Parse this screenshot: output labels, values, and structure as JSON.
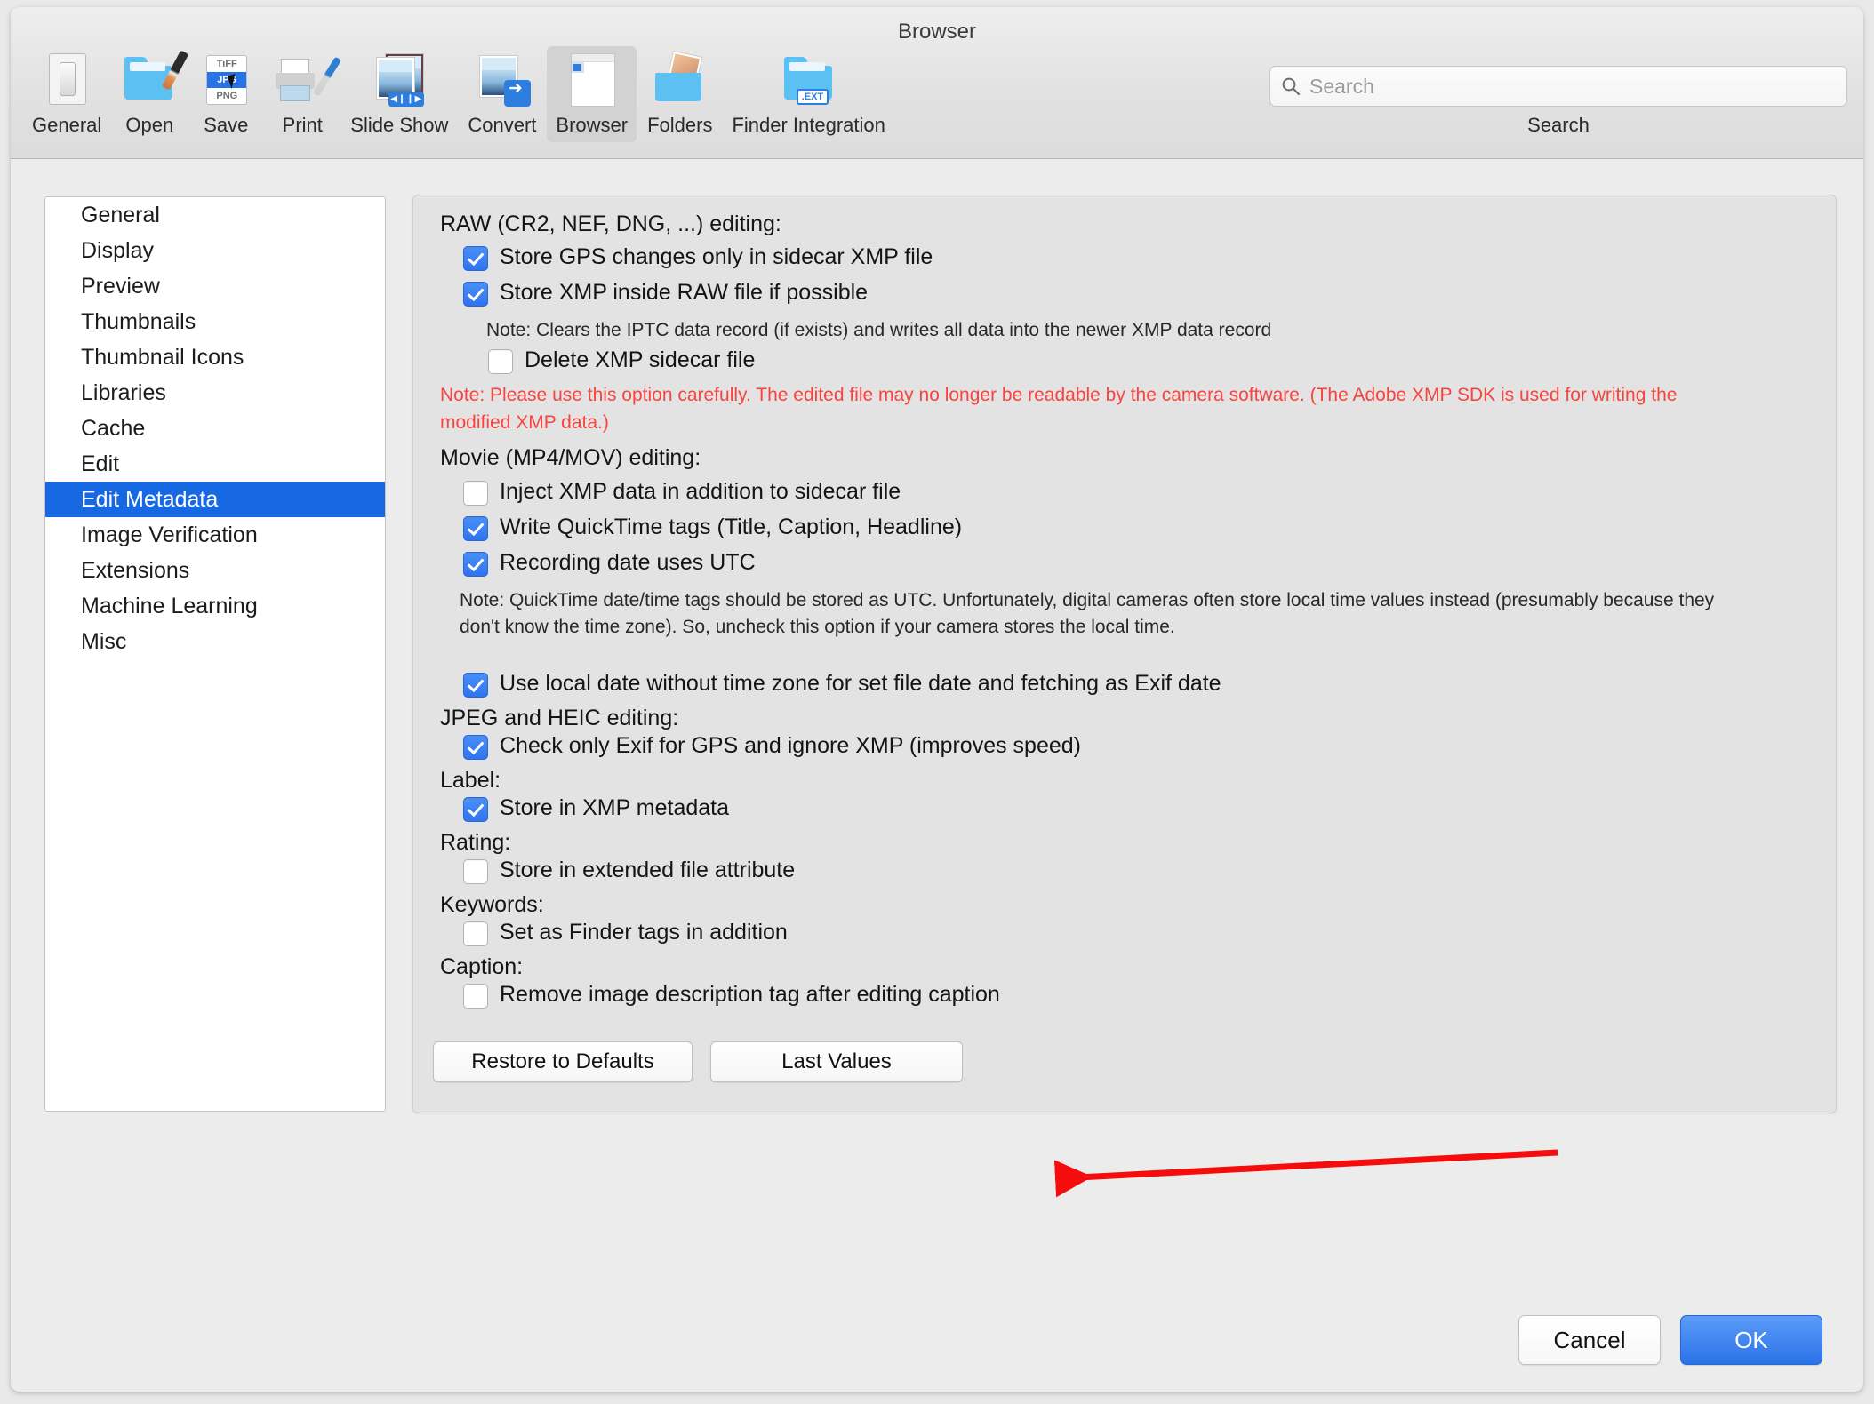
{
  "window": {
    "title": "Browser"
  },
  "toolbar": {
    "items": [
      {
        "label": "General",
        "icon": "switch-icon",
        "selected": false
      },
      {
        "label": "Open",
        "icon": "folder-brush-icon",
        "selected": false
      },
      {
        "label": "Save",
        "icon": "file-formats-icon",
        "selected": false
      },
      {
        "label": "Print",
        "icon": "printer-icon",
        "selected": false
      },
      {
        "label": "Slide Show",
        "icon": "slideshow-icon",
        "selected": false
      },
      {
        "label": "Convert",
        "icon": "convert-icon",
        "selected": false
      },
      {
        "label": "Browser",
        "icon": "browser-window-icon",
        "selected": true
      },
      {
        "label": "Folders",
        "icon": "folders-photos-icon",
        "selected": false
      },
      {
        "label": "Finder Integration",
        "icon": "finder-ext-icon",
        "selected": false
      }
    ],
    "formats": {
      "top": "TiFF",
      "middle": "JPG",
      "bottom": "PNG"
    },
    "ext_badge": ".EXT"
  },
  "search": {
    "placeholder": "Search",
    "value": "",
    "caption": "Search",
    "icon": "search-icon"
  },
  "sidebar": {
    "items": [
      {
        "label": "General",
        "selected": false
      },
      {
        "label": "Display",
        "selected": false
      },
      {
        "label": "Preview",
        "selected": false
      },
      {
        "label": "Thumbnails",
        "selected": false
      },
      {
        "label": "Thumbnail Icons",
        "selected": false
      },
      {
        "label": "Libraries",
        "selected": false
      },
      {
        "label": "Cache",
        "selected": false
      },
      {
        "label": "Edit",
        "selected": false
      },
      {
        "label": "Edit Metadata",
        "selected": true
      },
      {
        "label": "Image Verification",
        "selected": false
      },
      {
        "label": "Extensions",
        "selected": false
      },
      {
        "label": "Machine Learning",
        "selected": false
      },
      {
        "label": "Misc",
        "selected": false
      }
    ]
  },
  "panel": {
    "raw_heading": "RAW (CR2, NEF, DNG, ...) editing:",
    "cb_store_gps": {
      "label": "Store GPS changes only in sidecar XMP file",
      "checked": true
    },
    "cb_store_xmp_raw": {
      "label": "Store XMP inside RAW file if possible",
      "checked": true
    },
    "note_iptc": "Note: Clears the IPTC data record (if exists) and writes all data into the newer XMP data record",
    "cb_delete_sidecar": {
      "label": "Delete XMP sidecar file",
      "checked": false
    },
    "note_red": "Note: Please use this option carefully. The edited file may no longer be readable by the camera software. (The Adobe XMP SDK is used for writing the modified XMP data.)",
    "movie_heading": "Movie (MP4/MOV) editing:",
    "cb_inject_xmp": {
      "label": "Inject XMP data in addition to sidecar file",
      "checked": false
    },
    "cb_quicktime_tags": {
      "label": "Write QuickTime tags (Title, Caption, Headline)",
      "checked": true
    },
    "cb_recording_utc": {
      "label": "Recording date uses UTC",
      "checked": true
    },
    "note_quicktime": "Note: QuickTime date/time tags should be stored as UTC. Unfortunately, digital cameras often store local time values instead (presumably because they don't know the time zone). So, uncheck this option if your camera stores the local time.",
    "cb_local_date": {
      "label": "Use local date without time zone for set file date and fetching as Exif date",
      "checked": true
    },
    "jpeg_heading": "JPEG and HEIC editing:",
    "cb_check_exif_gps": {
      "label": "Check only Exif for GPS and ignore XMP (improves speed)",
      "checked": true
    },
    "label_heading": "Label:",
    "cb_store_xmp_meta": {
      "label": "Store in XMP metadata",
      "checked": true
    },
    "rating_heading": "Rating:",
    "cb_store_xattr": {
      "label": "Store in extended file attribute",
      "checked": false
    },
    "keywords_heading": "Keywords:",
    "cb_finder_tags": {
      "label": "Set as Finder tags in addition",
      "checked": false
    },
    "caption_heading": "Caption:",
    "cb_remove_desc": {
      "label": "Remove image description tag after editing caption",
      "checked": false
    },
    "btn_restore": "Restore to Defaults",
    "btn_last_values": "Last Values"
  },
  "footer": {
    "cancel": "Cancel",
    "ok": "OK"
  },
  "annotation": {
    "arrow_color": "#f50d0d",
    "points_to": "Remove image description tag after editing caption"
  },
  "colors": {
    "accent_blue": "#1668e3",
    "checkbox_blue": "#2f74ef",
    "warning_red": "#f8443e",
    "annotation_red": "#f50d0d",
    "window_bg": "#ececec",
    "panel_bg": "#e3e3e3"
  }
}
